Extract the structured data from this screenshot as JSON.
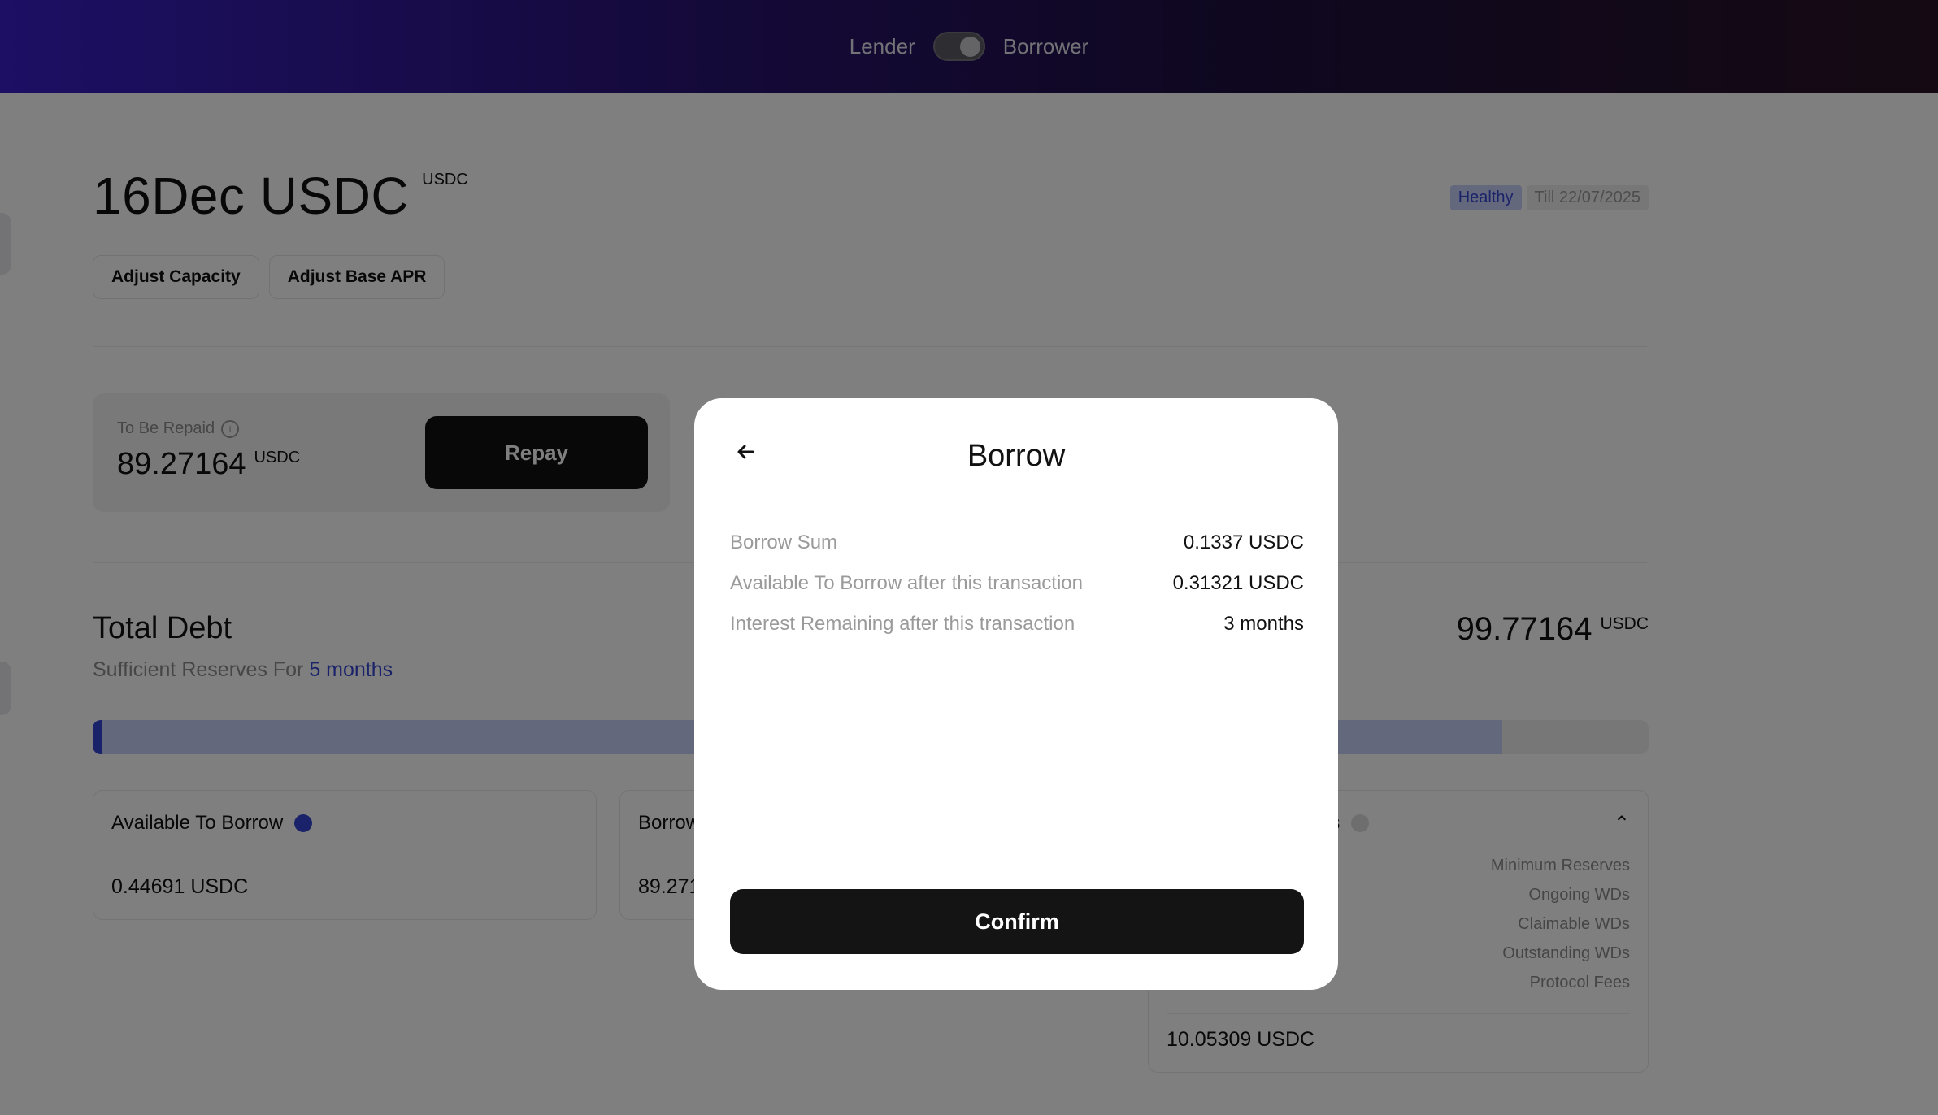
{
  "header": {
    "lender_label": "Lender",
    "borrower_label": "Borrower"
  },
  "market": {
    "title": "16Dec USDC",
    "title_unit": "USDC",
    "status_badge": "Healthy",
    "till_badge": "Till 22/07/2025",
    "actions": {
      "adjust_capacity": "Adjust Capacity",
      "adjust_base_apr": "Adjust Base APR"
    }
  },
  "repay": {
    "label": "To Be Repaid",
    "value": "89.27164",
    "unit": "USDC",
    "button": "Repay"
  },
  "debt": {
    "title": "Total Debt",
    "sub_prefix": "Sufficient Reserves For",
    "sub_months": "5 months",
    "total_value": "99.77164",
    "total_unit": "USDC",
    "bar": {
      "available_fraction": 0.006,
      "borrowed_fraction": 0.9
    }
  },
  "cards": {
    "available": {
      "label": "Available To Borrow",
      "value": "0.44691 USDC",
      "color": "#3447d4"
    },
    "borrowed": {
      "label": "Borrow",
      "value": "89.271",
      "color": "#c9d1fb"
    },
    "reserves": {
      "label": "ns",
      "items": [
        "Minimum Reserves",
        "Ongoing WDs",
        "Claimable WDs",
        "Outstanding WDs",
        "Protocol Fees"
      ],
      "value": "10.05309 USDC",
      "color": "#dcdcdc"
    }
  },
  "modal": {
    "title": "Borrow",
    "rows": [
      {
        "label": "Borrow Sum",
        "value": "0.1337 USDC"
      },
      {
        "label": "Available To Borrow after this transaction",
        "value": "0.31321 USDC"
      },
      {
        "label": "Interest Remaining after this transaction",
        "value": "3 months"
      }
    ],
    "confirm": "Confirm"
  },
  "icons": {
    "back": "arrow-left-icon",
    "info": "info-icon",
    "collapse": "chevron-up-icon",
    "toggle": "toggle-switch"
  }
}
